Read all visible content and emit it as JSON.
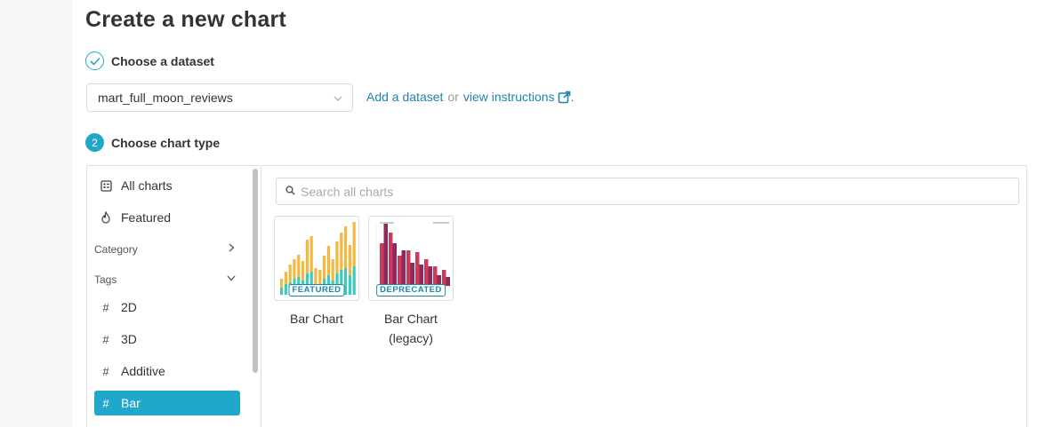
{
  "page": {
    "title": "Create a new chart"
  },
  "steps": [
    {
      "number": "",
      "label": "Choose a dataset",
      "state": "complete"
    },
    {
      "number": "2",
      "label": "Choose chart type",
      "state": "active"
    }
  ],
  "dataset": {
    "selected": "mart_full_moon_reviews",
    "add_link": "Add a dataset",
    "or_text": "or",
    "instructions_link": "view instructions",
    "trailing": "."
  },
  "sidebar": {
    "all_charts": "All charts",
    "featured": "Featured",
    "category": "Category",
    "tags": "Tags",
    "tag_items": [
      {
        "label": "2D",
        "active": false
      },
      {
        "label": "3D",
        "active": false
      },
      {
        "label": "Additive",
        "active": false
      },
      {
        "label": "Bar",
        "active": true
      }
    ]
  },
  "search": {
    "placeholder": "Search all charts",
    "value": ""
  },
  "charts": [
    {
      "label": "Bar Chart",
      "badge": "FEATURED"
    },
    {
      "label": "Bar Chart\n(legacy)",
      "badge": "DEPRECATED"
    }
  ],
  "colors": {
    "accent": "#20a7c9",
    "link": "#1f84a8",
    "bar_yellow": "#f3b83f",
    "bar_teal": "#3ec9b8",
    "bar_crimson": "#d1385a",
    "bar_plum": "#8b2a5c"
  }
}
